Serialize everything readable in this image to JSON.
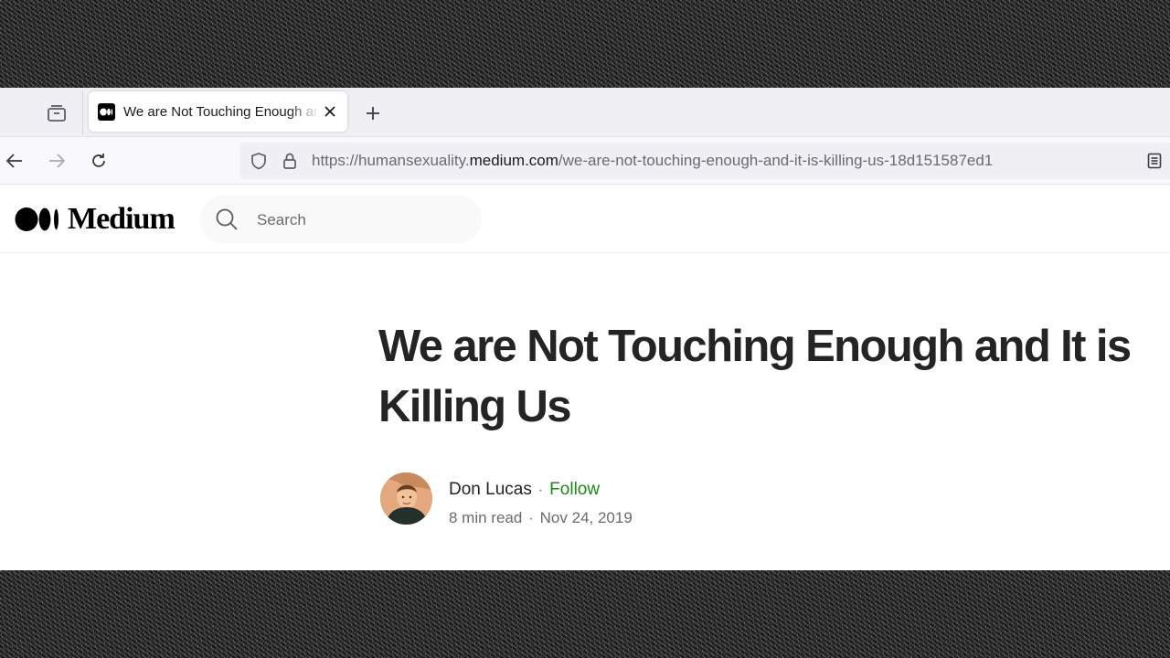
{
  "browser": {
    "tab": {
      "title": "We are Not Touching Enough and It is Killing Us"
    },
    "url": {
      "prefix": "https://humansexuality.",
      "host": "medium.com",
      "path": "/we-are-not-touching-enough-and-it-is-killing-us-18d151587ed1"
    }
  },
  "site": {
    "logo_text": "Medium",
    "search_placeholder": "Search"
  },
  "article": {
    "title": "We are Not Touching Enough and It is Killing Us",
    "author": "Don Lucas",
    "separator": "·",
    "follow_label": "Follow",
    "read_time": "8 min read",
    "date": "Nov 24, 2019"
  },
  "colors": {
    "follow": "#1a8917",
    "headline": "#242424",
    "meta": "#6b6b6b"
  }
}
